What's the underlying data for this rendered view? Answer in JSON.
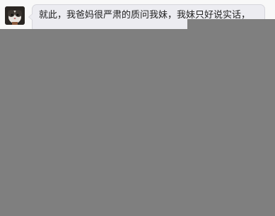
{
  "message": {
    "text": "就此，我爸妈很严肃的质问我妹，我妹只好说实话，"
  },
  "colors": {
    "page_background": "#f8f8f8",
    "bubble_background": "#ececf1",
    "bubble_border": "#d6d6dc",
    "overlay": "#7f7f7f"
  }
}
